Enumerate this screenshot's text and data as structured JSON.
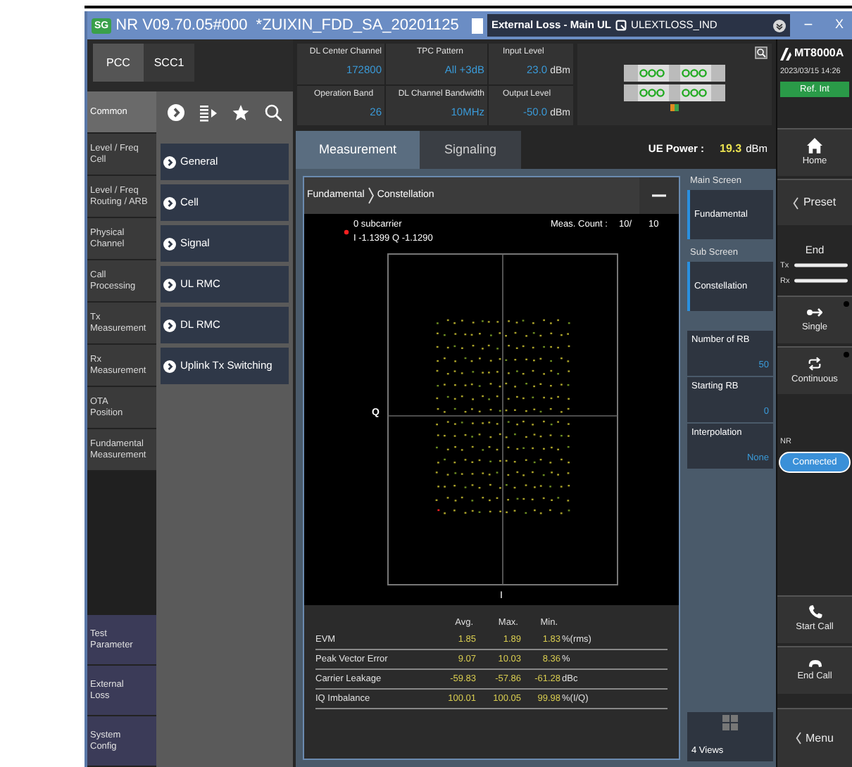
{
  "window": {
    "badge": "SG",
    "title": "NR V09.70.05#000  *ZUIXIN_FDD_SA_20201125",
    "loss_field": {
      "label": "External Loss - Main UL",
      "value": "ULEXTLOSS_IND"
    },
    "minimize": "−",
    "close": "X"
  },
  "carrier_tabs": [
    {
      "label": "PCC",
      "selected": true
    },
    {
      "label": "SCC1",
      "selected": false
    }
  ],
  "parameters": [
    {
      "label": "DL Center Channel",
      "value": "172800"
    },
    {
      "label": "TPC Pattern",
      "value": "All +3dB"
    },
    {
      "label": "Input Level",
      "value": "23.0",
      "unit": "dBm"
    },
    {
      "label": "Operation Band",
      "value": "26"
    },
    {
      "label": "DL Channel Bandwidth",
      "value": "10MHz"
    },
    {
      "label": "Output Level",
      "value": "-50.0",
      "unit": "dBm"
    }
  ],
  "instrument": {
    "model": "MT8000A",
    "datetime": "2023/03/15 14:26",
    "reference": "Ref. Int"
  },
  "nav": {
    "items": [
      {
        "label": "Common",
        "selected": true
      },
      {
        "label": "Level / Freq\nCell",
        "selected": false
      },
      {
        "label": "Level / Freq\nRouting / ARB",
        "selected": false
      },
      {
        "label": "Physical\nChannel",
        "selected": false
      },
      {
        "label": "Call\nProcessing",
        "selected": false
      },
      {
        "label": "Tx\nMeasurement",
        "selected": false
      },
      {
        "label": "Rx\nMeasurement",
        "selected": false
      },
      {
        "label": "OTA\nPosition",
        "selected": false
      },
      {
        "label": "Fundamental\nMeasurement",
        "selected": false
      }
    ],
    "bottom_items": [
      "Test\nParameter",
      "External\nLoss",
      "System\nConfig"
    ]
  },
  "menu_items": [
    "General",
    "Cell",
    "Signal",
    "UL RMC",
    "DL RMC",
    "Uplink Tx Switching"
  ],
  "main_tabs": [
    {
      "label": "Measurement",
      "selected": true
    },
    {
      "label": "Signaling",
      "selected": false
    }
  ],
  "ue_power": {
    "label": "UE Power :",
    "value": "19.3",
    "unit": "dBm"
  },
  "panel": {
    "breadcrumb": [
      "Fundamental",
      "Constellation"
    ],
    "marker": {
      "label": "0 subcarrier",
      "readout": "I -1.1399 Q -1.1290"
    },
    "meas_count": {
      "label": "Meas. Count :",
      "current": "10/",
      "total": "10"
    },
    "y_axis": "Q",
    "x_axis": "I"
  },
  "results": {
    "columns": [
      "Avg.",
      "Max.",
      "Min."
    ],
    "rows": [
      {
        "name": "EVM",
        "avg": "1.85",
        "max": "1.89",
        "min": "1.83",
        "unit": "%(rms)"
      },
      {
        "name": "Peak Vector Error",
        "avg": "9.07",
        "max": "10.03",
        "min": "8.36",
        "unit": "%"
      },
      {
        "name": "Carrier Leakage",
        "avg": "-59.83",
        "max": "-57.86",
        "min": "-61.28",
        "unit": "dBc"
      },
      {
        "name": "IQ Imbalance",
        "avg": "100.01",
        "max": "100.05",
        "min": "99.98",
        "unit": "%(I/Q)"
      }
    ]
  },
  "screen_settings": {
    "main_label": "Main Screen",
    "main": "Fundamental",
    "sub_label": "Sub Screen",
    "sub": "Constellation",
    "parameters": [
      {
        "label": "Number of RB",
        "value": "50"
      },
      {
        "label": "Starting RB",
        "value": "0"
      },
      {
        "label": "Interpolation",
        "value": "None"
      }
    ],
    "views": "4 Views"
  },
  "side_panel": {
    "home": "Home",
    "preset": "Preset",
    "end": "End",
    "tx": "Tx",
    "rx": "Rx",
    "single": "Single",
    "continuous": "Continuous",
    "nr_label": "NR",
    "nr_status": "Connected",
    "start_call": "Start Call",
    "end_call": "End Call",
    "menu": "Menu"
  }
}
